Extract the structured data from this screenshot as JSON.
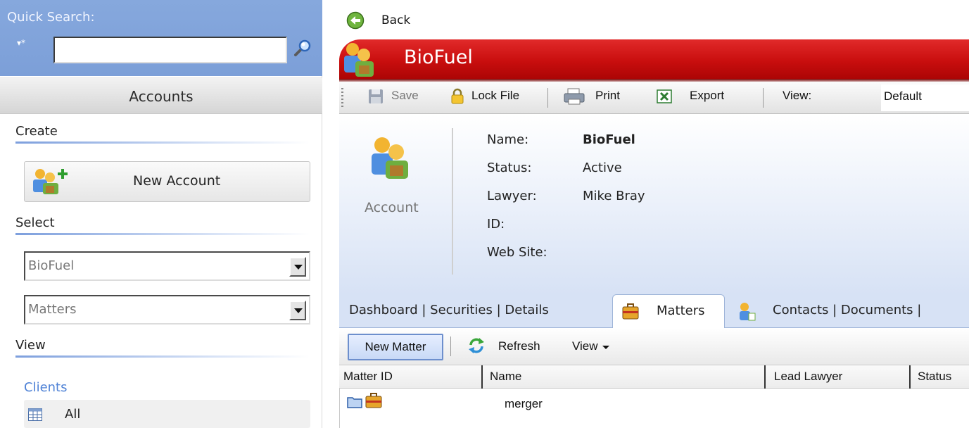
{
  "sidebar": {
    "quick_search": {
      "label": "Quick Search:",
      "flag": "▾*",
      "value": "",
      "placeholder": ""
    },
    "header_tab": "Accounts",
    "create": {
      "title": "Create",
      "new_account_label": "New Account"
    },
    "select": {
      "title": "Select",
      "account_value": "BioFuel",
      "section_value": "Matters"
    },
    "view": {
      "title": "View",
      "clients_link": "Clients",
      "all_label": "All"
    }
  },
  "nav": {
    "back_label": "Back"
  },
  "record": {
    "title": "BioFuel",
    "type_caption": "Account"
  },
  "toolbar": {
    "save": "Save",
    "lock_file": "Lock File",
    "print": "Print",
    "export": "Export",
    "view_label": "View:",
    "view_value": "Default"
  },
  "fields": [
    {
      "label": "Name:",
      "value": "BioFuel"
    },
    {
      "label": "Status:",
      "value": "Active"
    },
    {
      "label": "Lawyer:",
      "value": "Mike Bray"
    },
    {
      "label": "ID:",
      "value": ""
    },
    {
      "label": "Web Site:",
      "value": ""
    }
  ],
  "tabs": {
    "left_group": "Dashboard | Securities | Details",
    "active": "Matters",
    "right_group": "Contacts | Documents |"
  },
  "matters_toolbar": {
    "new_matter": "New Matter",
    "refresh": "Refresh",
    "view": "View"
  },
  "grid": {
    "columns": [
      "Matter ID",
      "Name",
      "Lead Lawyer",
      "Status"
    ],
    "rows": [
      {
        "matter_id": "",
        "name": "merger"
      }
    ]
  },
  "colors": {
    "title_bar": "#c90e0e",
    "quick_search_bg": "#7c9fd8",
    "details_gradient_end": "#d7e2f5",
    "clients_link": "#4f82d6"
  },
  "icons": [
    "magnifier-icon",
    "account-add-icon",
    "grid-icon",
    "back-arrow-icon",
    "account-icon",
    "save-icon",
    "lock-icon",
    "printer-icon",
    "excel-icon",
    "briefcase-icon",
    "contacts-icon",
    "refresh-icon",
    "folder-icon"
  ]
}
